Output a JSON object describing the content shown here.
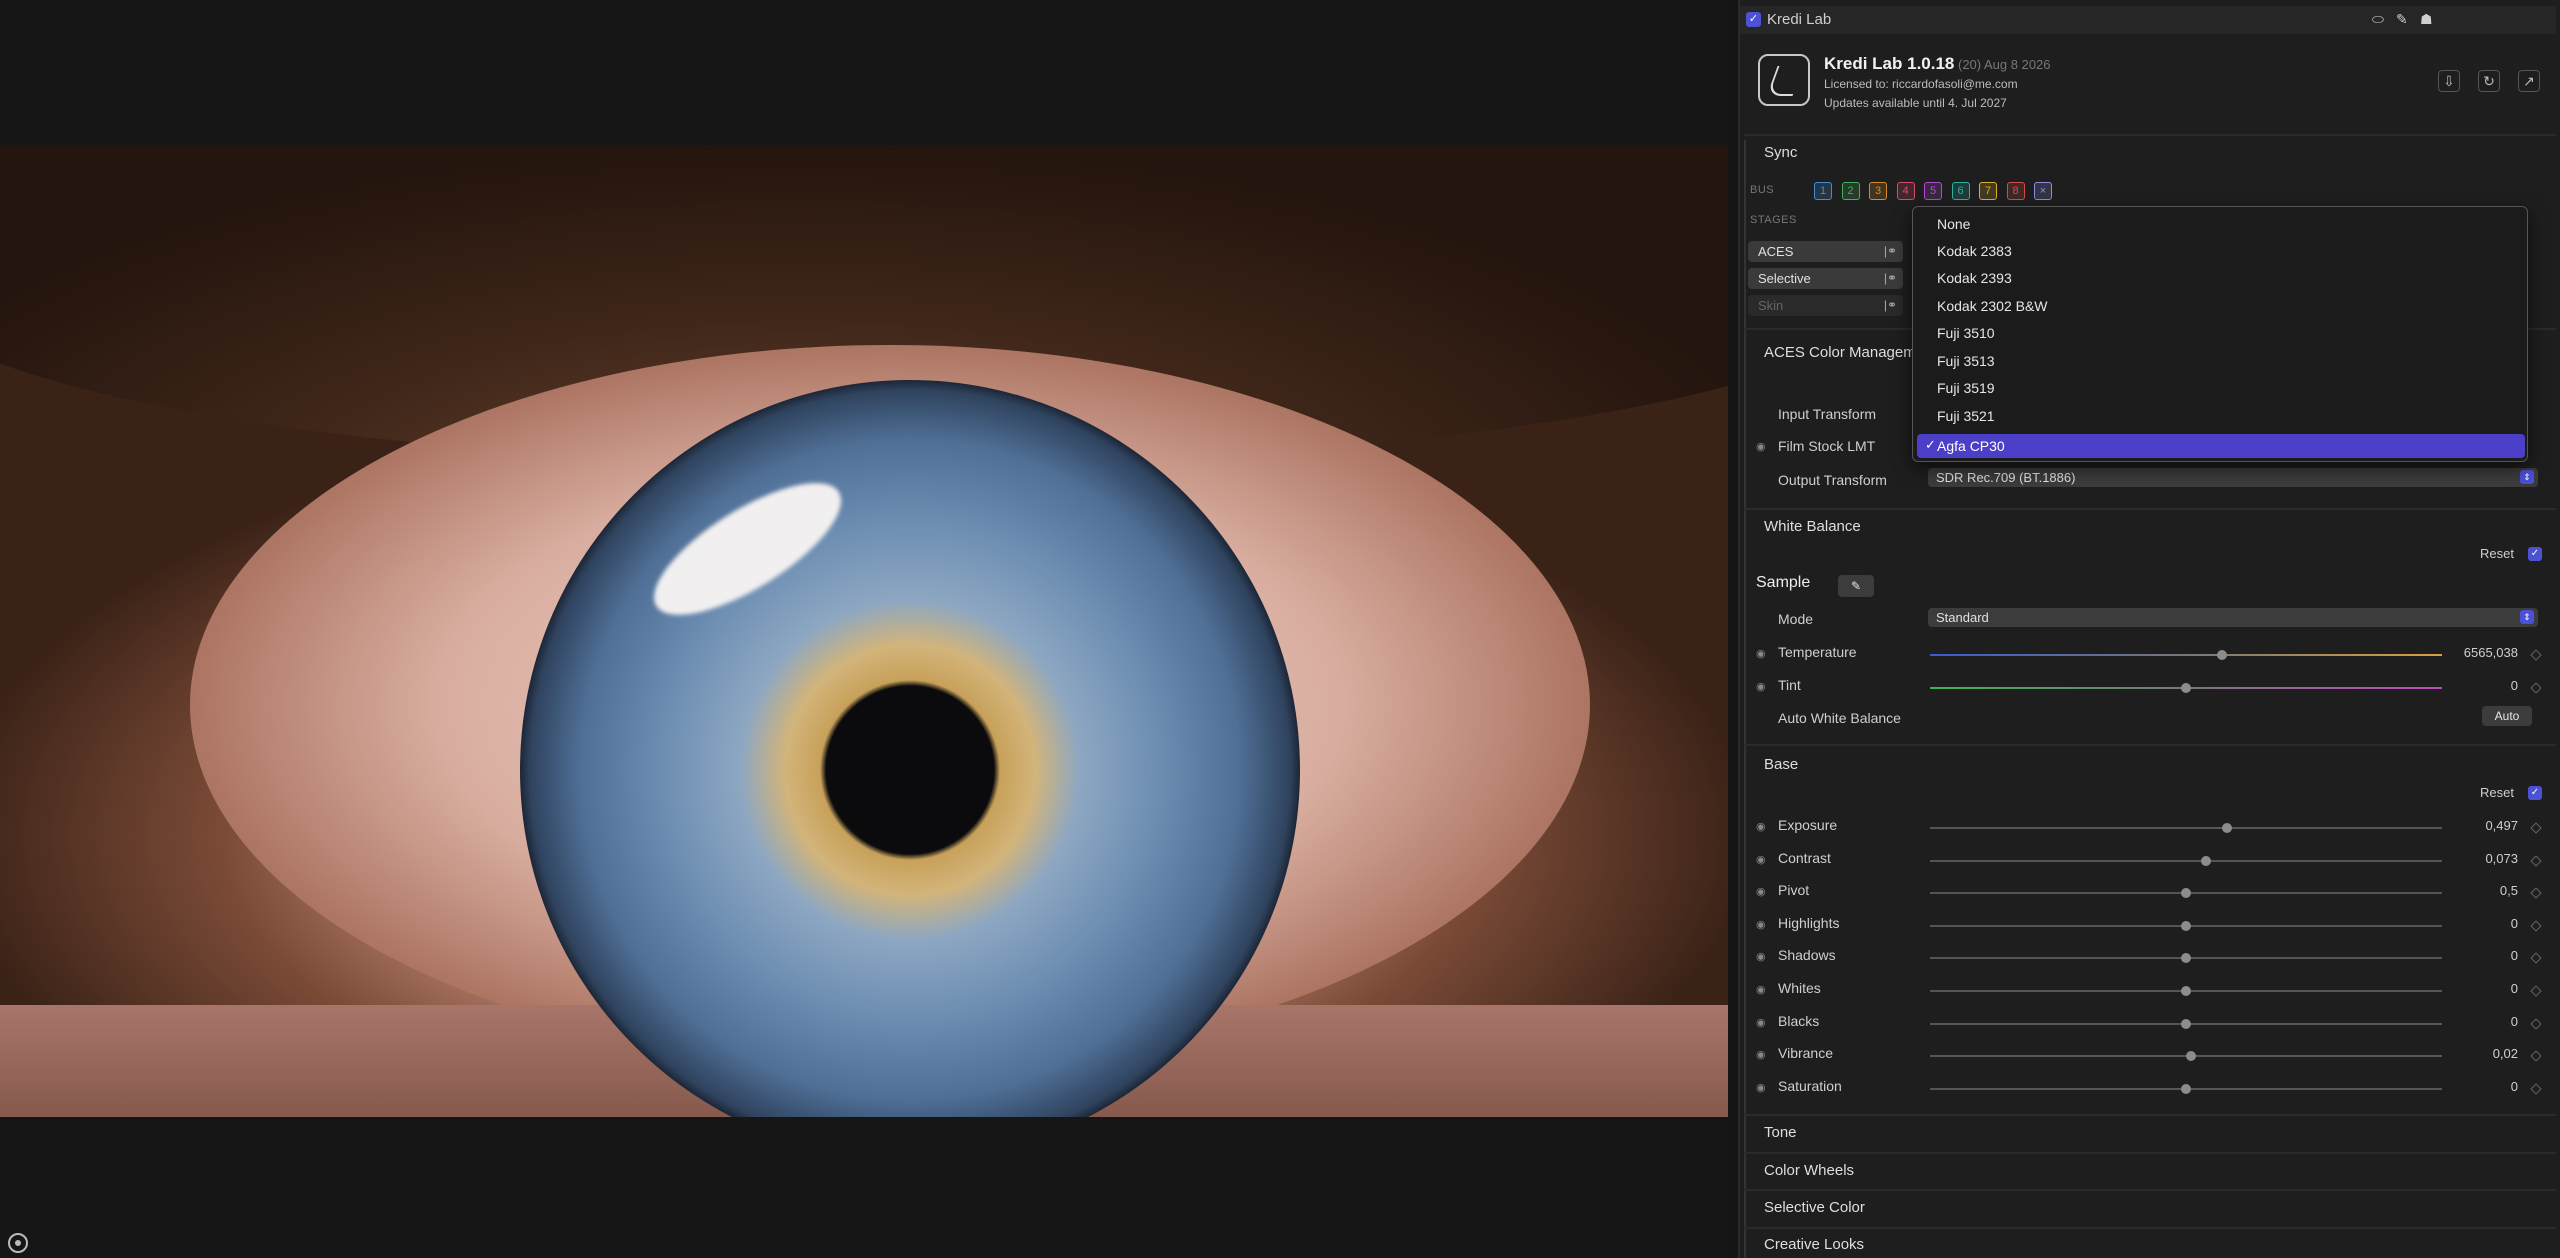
{
  "header": {
    "title": "Kredi Lab"
  },
  "product": {
    "name": "Kredi Lab 1.0.18",
    "build": "(20) Aug 8 2026",
    "licensed": "Licensed to: riccardofasoli@me.com",
    "updates": "Updates available until 4. Jul 2027"
  },
  "sync": {
    "title": "Sync",
    "bus_label": "BUS",
    "bus": [
      {
        "label": "1",
        "color": "#3f8fd8"
      },
      {
        "label": "2",
        "color": "#3fb25a"
      },
      {
        "label": "3",
        "color": "#d88a2a"
      },
      {
        "label": "4",
        "color": "#d84a6a"
      },
      {
        "label": "5",
        "color": "#b24ad8"
      },
      {
        "label": "6",
        "color": "#2ab2a2"
      },
      {
        "label": "7",
        "color": "#d8b02a"
      },
      {
        "label": "8",
        "color": "#d84a4a"
      },
      {
        "label": "×",
        "color": "#8c8ce0"
      }
    ],
    "stages_label": "STAGES",
    "stages": [
      "ACES",
      "Selective",
      "Skin"
    ]
  },
  "aces": {
    "title": "ACES Color Managem",
    "input_transform": "Input Transform",
    "film_stock": "Film Stock LMT",
    "output_transform": "Output Transform",
    "output_value": "SDR Rec.709 (BT.1886)"
  },
  "dropdown": {
    "items": [
      "None",
      "Kodak 2383",
      "Kodak 2393",
      "Kodak 2302 B&W",
      "Fuji 3510",
      "Fuji 3513",
      "Fuji 3519",
      "Fuji 3521"
    ],
    "selected": "Agfa CP30",
    "check": "✓"
  },
  "white_balance": {
    "title": "White Balance",
    "reset": "Reset",
    "sample": "Sample",
    "mode_label": "Mode",
    "mode_value": "Standard",
    "temperature_label": "Temperature",
    "temperature_value": "6565,038",
    "temperature_pos": 0.57,
    "tint_label": "Tint",
    "tint_value": "0",
    "tint_pos": 0.5,
    "auto_label": "Auto White Balance",
    "auto_button": "Auto"
  },
  "base": {
    "title": "Base",
    "reset": "Reset",
    "sliders": [
      {
        "label": "Exposure",
        "value": "0,497",
        "pos": 0.58
      },
      {
        "label": "Contrast",
        "value": "0,073",
        "pos": 0.54
      },
      {
        "label": "Pivot",
        "value": "0,5",
        "pos": 0.5
      },
      {
        "label": "Highlights",
        "value": "0",
        "pos": 0.5
      },
      {
        "label": "Shadows",
        "value": "0",
        "pos": 0.5
      },
      {
        "label": "Whites",
        "value": "0",
        "pos": 0.5
      },
      {
        "label": "Blacks",
        "value": "0",
        "pos": 0.5
      },
      {
        "label": "Vibrance",
        "value": "0,02",
        "pos": 0.51
      },
      {
        "label": "Saturation",
        "value": "0",
        "pos": 0.5
      }
    ]
  },
  "collapsed_sections": [
    "Tone",
    "Color Wheels",
    "Selective Color",
    "Creative Looks"
  ]
}
